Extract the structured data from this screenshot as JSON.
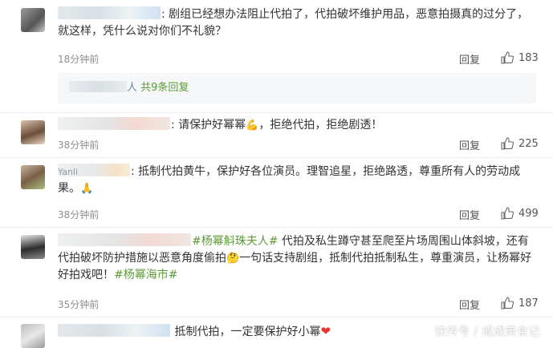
{
  "comments": [
    {
      "nickname": "",
      "text": "剧组已经想办法阻止代拍了，代拍破坏维护用品，恶意拍摄真的过分了，就这样，凭什么说对你们不礼貌？",
      "time": "18分钟前",
      "reply_label": "回复",
      "likes": "183"
    },
    {
      "nickname": "",
      "text": "请保护好幂幂",
      "text2": "，拒绝代拍，拒绝剧透！",
      "time": "38分钟前",
      "reply_label": "回复",
      "likes": "225"
    },
    {
      "nickname": "Yanli",
      "text": "抵制代拍黄牛，保护好各位演员。理智追星，拒绝路透，尊重所有人的劳动成果。",
      "time": "38分钟前",
      "reply_label": "回复",
      "likes": "499"
    },
    {
      "nickname": "",
      "tag1": "#杨幂斛珠夫人#",
      "text": " 代拍及私生蹲守甚至爬至片场周围山体斜坡，还有代拍破坏防护措施以恶意角度偷拍",
      "text2": "一句话支持剧组，抵制代拍抵制私生，尊重演员，让杨幂好好拍戏吧！",
      "tag2": "#杨幂海市#",
      "time": "35分钟前",
      "reply_label": "回复",
      "likes": "187"
    },
    {
      "nickname": "",
      "text": "抵制代拍，一定要保护好小幂",
      "time": "",
      "reply_label": "",
      "likes": ""
    }
  ],
  "sub_replies": {
    "name_suffix": "人",
    "count_label": "共9条回复"
  },
  "icons": {
    "like": "thumbs-up-icon",
    "flex": "flexed-biceps-emoji",
    "clap": "praying-hands-emoji",
    "heart": "red-heart-emoji",
    "face": "face-emoji"
  },
  "colors": {
    "topic_tag": "#5d9b36",
    "reply_link": "#5d9b36",
    "meta": "#8e8e8e"
  },
  "watermark": "快传号 / 成成美食记"
}
